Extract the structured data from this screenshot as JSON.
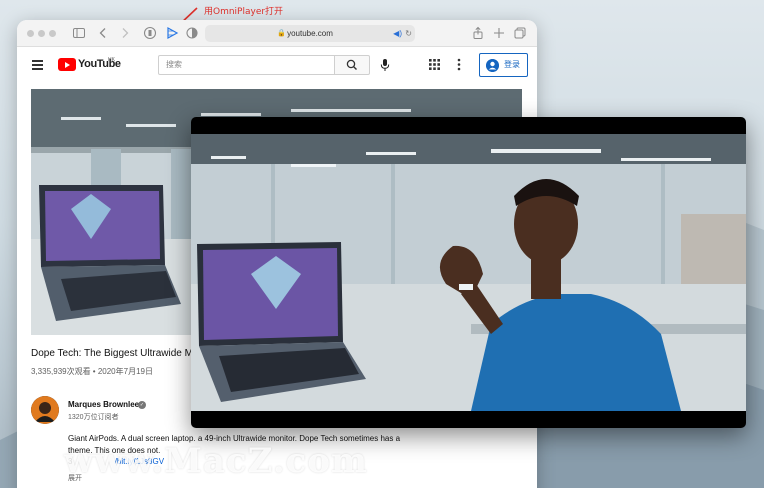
{
  "annotation": {
    "text": "用OmniPlayer打开"
  },
  "browser": {
    "url": "youtube.com",
    "toolbar_icons": [
      "sidebar-icon",
      "back-icon",
      "forward-icon",
      "privacy-icon",
      "omniplayer-icon",
      "contrast-icon",
      "share-icon",
      "new-tab-icon",
      "tabs-icon"
    ]
  },
  "youtube": {
    "logo_text": "YouTube",
    "region": "HK",
    "search_placeholder": "搜索",
    "signin_label": "登录"
  },
  "video": {
    "title": "Dope Tech: The Biggest Ultrawide M",
    "meta": "3,335,939次观看 • 2020年7月19日",
    "channel": "Marques Brownlee",
    "subscribers": "1320万位订阅者",
    "description": "Giant AirPods. A dual screen laptop. a 49-inch Ultrawide monitor. Dope Tech sometimes has a theme. This one does not.",
    "desc_line2_prefix": "3",
    "desc_link": "/bit.ly/1Js8GV",
    "expand": "展开"
  },
  "watermark": {
    "text": "www.MacZ.com"
  }
}
